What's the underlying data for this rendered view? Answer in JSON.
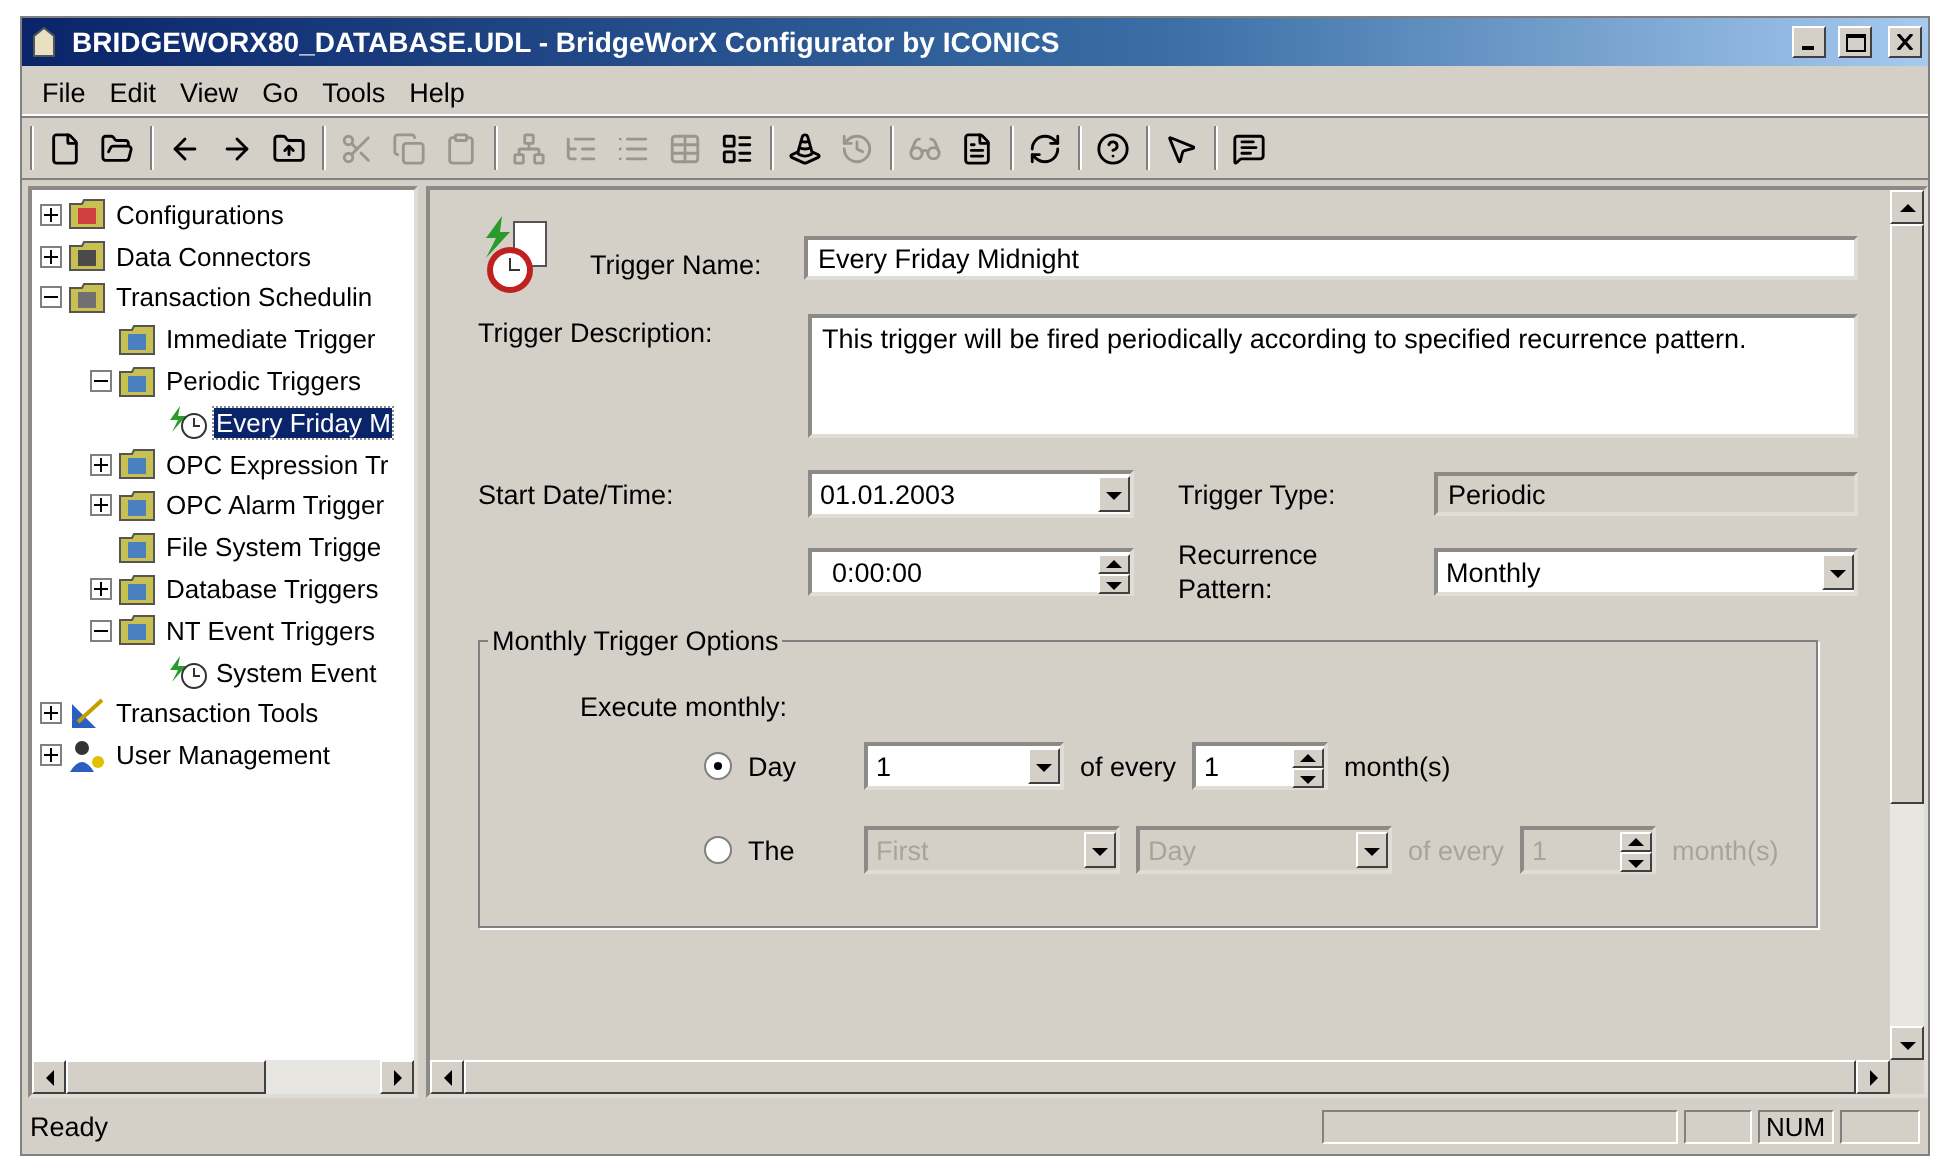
{
  "window": {
    "title": "BRIDGEWORX80_DATABASE.UDL - BridgeWorX Configurator by ICONICS"
  },
  "menu": [
    "File",
    "Edit",
    "View",
    "Go",
    "Tools",
    "Help"
  ],
  "toolbar": [
    [
      {
        "disabled": false
      },
      {
        "disabled": false
      }
    ],
    [
      {
        "disabled": false
      },
      {
        "disabled": false
      },
      {
        "disabled": false
      }
    ],
    [
      {
        "disabled": true
      },
      {
        "disabled": true
      },
      {
        "disabled": true
      }
    ],
    [
      {
        "disabled": true
      },
      {
        "disabled": true
      },
      {
        "disabled": true
      },
      {
        "disabled": true
      },
      {
        "disabled": false
      }
    ],
    [
      {
        "disabled": false
      },
      {
        "disabled": true
      }
    ],
    [
      {
        "disabled": true
      },
      {
        "disabled": false
      }
    ],
    [
      {
        "disabled": false
      }
    ],
    [
      {
        "disabled": false
      }
    ],
    [
      {
        "disabled": false
      }
    ],
    [
      {
        "disabled": false
      }
    ]
  ],
  "tree": [
    {
      "label": "Configurations",
      "kind": "config",
      "expanded": false,
      "selected": false
    },
    {
      "label": "Data Connectors",
      "kind": "connector",
      "expanded": false,
      "selected": false
    },
    {
      "label": "Transaction Schedulin",
      "kind": "schedule",
      "expanded": true,
      "selected": false,
      "children": [
        {
          "label": "Immediate Trigger",
          "kind": "folder",
          "selected": false
        },
        {
          "label": "Periodic Triggers",
          "kind": "folder",
          "expanded": true,
          "selected": false,
          "children": [
            {
              "label": "Every Friday M",
              "kind": "trigger",
              "selected": true
            }
          ]
        },
        {
          "label": "OPC Expression Tr",
          "kind": "folder",
          "expanded": false,
          "selected": false
        },
        {
          "label": "OPC Alarm Trigger",
          "kind": "folder",
          "expanded": false,
          "selected": false
        },
        {
          "label": "File System Trigge",
          "kind": "folder",
          "selected": false
        },
        {
          "label": "Database Triggers",
          "kind": "folder",
          "expanded": false,
          "selected": false
        },
        {
          "label": "NT Event Triggers",
          "kind": "folder",
          "expanded": true,
          "selected": false,
          "children": [
            {
              "label": "System Event",
              "kind": "trigger",
              "selected": false
            }
          ]
        }
      ]
    },
    {
      "label": "Transaction Tools",
      "kind": "tools",
      "expanded": false,
      "selected": false
    },
    {
      "label": "User Management",
      "kind": "users",
      "expanded": false,
      "selected": false
    }
  ],
  "form": {
    "trigger_name": {
      "label": "Trigger Name:",
      "value": "Every Friday Midnight"
    },
    "trigger_description": {
      "label": "Trigger Description:",
      "value": "This trigger will be fired periodically according to specified recurrence pattern."
    },
    "start_date_time": {
      "label": "Start Date/Time:",
      "date": "01.01.2003",
      "time": "0:00:00"
    },
    "trigger_type": {
      "label": "Trigger Type:",
      "value": "Periodic"
    },
    "recurrence_pattern": {
      "label": "Recurrence Pattern:",
      "value": "Monthly"
    }
  },
  "monthly_options": {
    "title": "Monthly Trigger Options",
    "heading": "Execute monthly:",
    "options": [
      {
        "label": "Day",
        "selected": true,
        "disabled": false,
        "parts": [
          {
            "kind": "dropdown",
            "value": "1"
          },
          {
            "kind": "text",
            "text": "of every"
          },
          {
            "kind": "spinner",
            "value": "1"
          },
          {
            "kind": "text",
            "text": "month(s)"
          }
        ]
      },
      {
        "label": "The",
        "selected": false,
        "disabled": true,
        "parts": [
          {
            "kind": "dropdown",
            "value": "First"
          },
          {
            "kind": "dropdown",
            "value": "Day"
          },
          {
            "kind": "text",
            "text": "of every"
          },
          {
            "kind": "spinner",
            "value": "1"
          },
          {
            "kind": "text",
            "text": "month(s)"
          }
        ]
      }
    ]
  },
  "status_bar": {
    "text": "Ready",
    "indicators": [
      "NUM"
    ]
  }
}
